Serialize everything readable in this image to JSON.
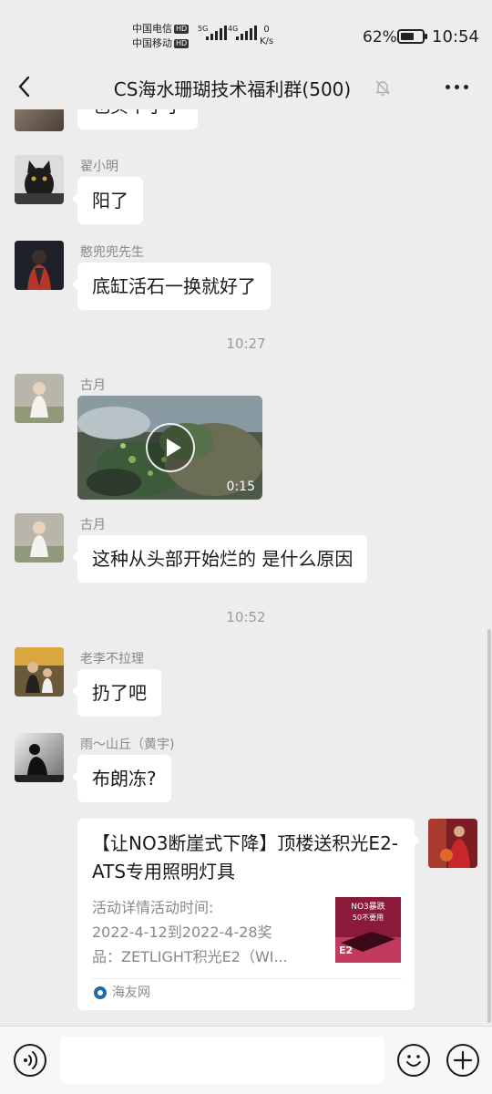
{
  "status_bar": {
    "carrier_1": "中国电信",
    "carrier_2": "中国移动",
    "hd_badge": "HD",
    "net_5g": "5G",
    "net_4g": "4G",
    "speed_value": "0",
    "speed_unit": "K/s",
    "battery_percent": "62%",
    "battery_level": 0.62,
    "time": "10:54"
  },
  "header": {
    "title": "CS海水珊瑚技术福利群(500)",
    "back_icon": "chevron-left-icon",
    "mute_icon": "bell-off-icon",
    "more_icon": "more-dots-icon"
  },
  "messages": [
    {
      "type": "text",
      "text": "也买不了了"
    },
    {
      "type": "text",
      "sender": "翟小明",
      "text": "阳了"
    },
    {
      "type": "text",
      "sender": "憨兜兜先生",
      "text": "底缸活石一换就好了"
    },
    {
      "type": "time",
      "text": "10:27"
    },
    {
      "type": "video",
      "sender": "古月",
      "duration": "0:15"
    },
    {
      "type": "text",
      "sender": "古月",
      "text": "这种从头部开始烂的 是什么原因"
    },
    {
      "type": "time",
      "text": "10:52"
    },
    {
      "type": "text",
      "sender": "老李不拉理",
      "text": "扔了吧"
    },
    {
      "type": "text",
      "sender": "雨～山丘（黄宇)",
      "text": "布朗冻?"
    },
    {
      "type": "link_card",
      "title": "【让NO3断崖式下降】顶楼送积光E2-ATS专用照明灯具",
      "description_lines": [
        "活动详情活动时间:",
        "2022-4-12到2022-4-28奖",
        "品：ZETLIGHT积光E2（WI..."
      ],
      "thumb_text_1": "NO3暴跌",
      "thumb_text_2": "50不要用",
      "thumb_text_3": "E2",
      "source": "海友网"
    }
  ],
  "input_bar": {
    "voice_icon": "voice-icon",
    "emoji_icon": "emoji-icon",
    "plus_icon": "plus-icon",
    "placeholder": ""
  },
  "colors": {
    "background": "#ededed",
    "bubble": "#ffffff",
    "sender": "#888888",
    "timestamp": "#9b9b9b"
  }
}
